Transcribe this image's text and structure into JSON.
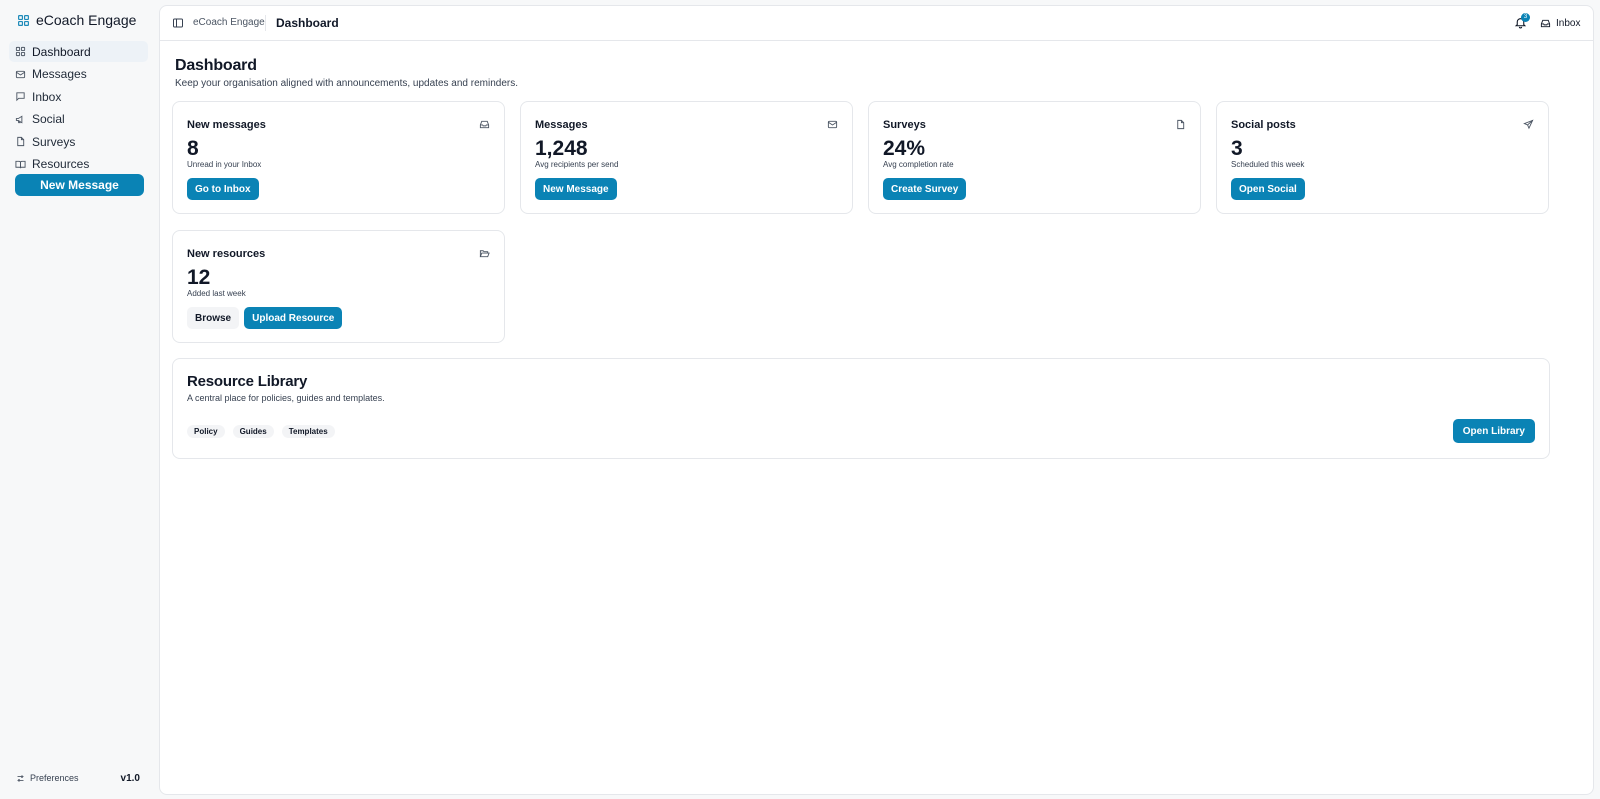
{
  "app": {
    "name": "eCoach Engage",
    "version": "v1.0"
  },
  "sidebar": {
    "items": [
      {
        "label": "Dashboard",
        "icon": "dashboard-icon",
        "active": true
      },
      {
        "label": "Messages",
        "icon": "mail-icon",
        "active": false
      },
      {
        "label": "Inbox",
        "icon": "chat-icon",
        "active": false
      },
      {
        "label": "Social",
        "icon": "megaphone-icon",
        "active": false
      },
      {
        "label": "Surveys",
        "icon": "file-icon",
        "active": false
      },
      {
        "label": "Resources",
        "icon": "book-icon",
        "active": false
      }
    ],
    "cta_label": "New Message",
    "footer": {
      "preferences_label": "Preferences"
    }
  },
  "header": {
    "breadcrumb_app": "eCoach Engage",
    "page": "Dashboard",
    "notifications_count": "3",
    "inbox_label": "Inbox"
  },
  "page": {
    "title": "Dashboard",
    "subtitle": "Keep your organisation aligned with announcements, updates and reminders."
  },
  "cards": [
    {
      "title": "New messages",
      "icon": "inbox-icon",
      "value": "8",
      "note": "Unread in your Inbox",
      "actions": [
        {
          "label": "Go to Inbox",
          "style": "primary"
        }
      ]
    },
    {
      "title": "Messages",
      "icon": "mail-icon",
      "value": "1,248",
      "note": "Avg recipients per send",
      "actions": [
        {
          "label": "New Message",
          "style": "primary"
        }
      ]
    },
    {
      "title": "Surveys",
      "icon": "file-icon",
      "value": "24%",
      "note": "Avg completion rate",
      "actions": [
        {
          "label": "Create Survey",
          "style": "primary"
        }
      ]
    },
    {
      "title": "Social posts",
      "icon": "send-icon",
      "value": "3",
      "note": "Scheduled this week",
      "actions": [
        {
          "label": "Open Social",
          "style": "primary"
        }
      ]
    },
    {
      "title": "New resources",
      "icon": "folder-open-icon",
      "value": "12",
      "note": "Added last week",
      "actions": [
        {
          "label": "Browse",
          "style": "secondary"
        },
        {
          "label": "Upload Resource",
          "style": "primary"
        }
      ]
    }
  ],
  "library": {
    "title": "Resource Library",
    "description": "A central place for policies, guides and templates.",
    "tags": [
      "Policy",
      "Guides",
      "Templates"
    ],
    "open_label": "Open Library"
  },
  "colors": {
    "accent": "#0a83b5",
    "background": "#f7f8f9",
    "surface": "#ffffff",
    "border": "#e5e7eb"
  }
}
